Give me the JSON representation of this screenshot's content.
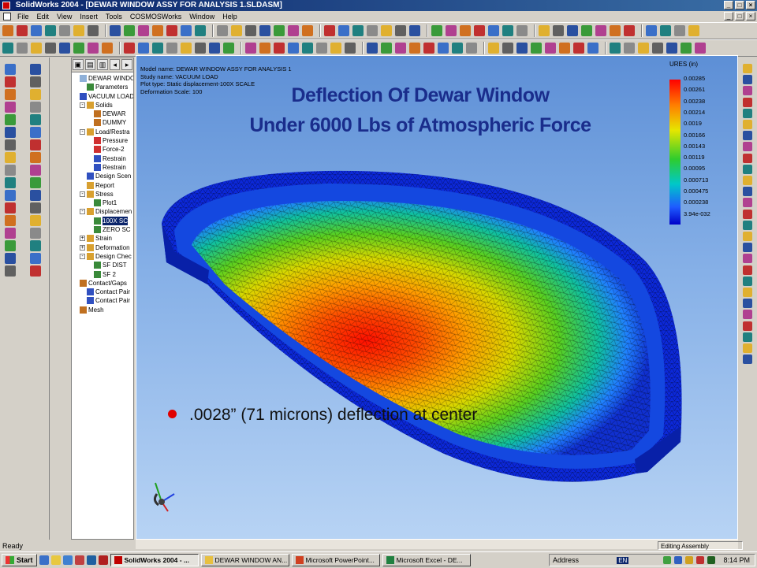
{
  "window": {
    "title": "SolidWorks 2004 - [DEWAR WINDOW ASSY FOR ANALYSIS 1.SLDASM]"
  },
  "menubar": [
    "File",
    "Edit",
    "View",
    "Insert",
    "Tools",
    "COSMOSWorks",
    "Window",
    "Help"
  ],
  "toolbar": {
    "row1_icon_count": 46,
    "row2_icon_count": 47
  },
  "feature_tree": {
    "tabs": [
      "part-icon",
      "properties-icon",
      "config-icon",
      "arrow-left-icon",
      "arrow-right-icon"
    ],
    "items": [
      {
        "label": "DEWAR WINDOW A",
        "indent": 0,
        "exp": "",
        "icon": "#8fb0d8"
      },
      {
        "label": "Parameters",
        "indent": 1,
        "exp": "",
        "icon": "#3a8a3a"
      },
      {
        "label": "VACUUM LOAD",
        "indent": 0,
        "exp": "",
        "icon": "#3050c0"
      },
      {
        "label": "Solids",
        "indent": 1,
        "exp": "-",
        "icon": "#d8a030"
      },
      {
        "label": "DEWAR",
        "indent": 2,
        "exp": "",
        "icon": "#c07020"
      },
      {
        "label": "DUMMY",
        "indent": 2,
        "exp": "",
        "icon": "#c07020"
      },
      {
        "label": "Load/Restra",
        "indent": 1,
        "exp": "-",
        "icon": "#d8a030"
      },
      {
        "label": "Pressure",
        "indent": 2,
        "exp": "",
        "icon": "#d03030"
      },
      {
        "label": "Force-2",
        "indent": 2,
        "exp": "",
        "icon": "#d03030"
      },
      {
        "label": "Restrain",
        "indent": 2,
        "exp": "",
        "icon": "#3050c0"
      },
      {
        "label": "Restrain",
        "indent": 2,
        "exp": "",
        "icon": "#3050c0"
      },
      {
        "label": "Design Scen",
        "indent": 1,
        "exp": "",
        "icon": "#3050c0"
      },
      {
        "label": "Report",
        "indent": 1,
        "exp": "",
        "icon": "#d8a030"
      },
      {
        "label": "Stress",
        "indent": 1,
        "exp": "-",
        "icon": "#d8a030"
      },
      {
        "label": "Plot1",
        "indent": 2,
        "exp": "",
        "icon": "#3a8a3a"
      },
      {
        "label": "Displacemen",
        "indent": 1,
        "exp": "-",
        "icon": "#d8a030"
      },
      {
        "label": "100X SC",
        "indent": 2,
        "exp": "",
        "icon": "#3a8a3a",
        "selected": true
      },
      {
        "label": "ZERO SC",
        "indent": 2,
        "exp": "",
        "icon": "#3a8a3a"
      },
      {
        "label": "Strain",
        "indent": 1,
        "exp": "+",
        "icon": "#d8a030"
      },
      {
        "label": "Deformation",
        "indent": 1,
        "exp": "+",
        "icon": "#d8a030"
      },
      {
        "label": "Design Chec",
        "indent": 1,
        "exp": "-",
        "icon": "#d8a030"
      },
      {
        "label": "SF DIST",
        "indent": 2,
        "exp": "",
        "icon": "#3a8a3a"
      },
      {
        "label": "SF 2",
        "indent": 2,
        "exp": "",
        "icon": "#3a8a3a"
      },
      {
        "label": "Contact/Gaps",
        "indent": 0,
        "exp": "",
        "icon": "#c07020"
      },
      {
        "label": "Contact Pair",
        "indent": 1,
        "exp": "",
        "icon": "#3050c0"
      },
      {
        "label": "Contact Pair",
        "indent": 1,
        "exp": "",
        "icon": "#3050c0"
      },
      {
        "label": "Mesh",
        "indent": 0,
        "exp": "",
        "icon": "#c07020"
      }
    ]
  },
  "plot_info": [
    "Model name: DEWAR WINDOW ASSY FOR ANALYSIS 1",
    "Study name: VACUUM LOAD",
    "Plot type: Static displacement-100X SCALE",
    "Deformation Scale: 100"
  ],
  "slide": {
    "title_line1": "Deflection Of Dewar Window",
    "title_line2": "Under 6000 Lbs of Atmospheric Force",
    "bullet": ".0028” (71 microns) deflection at center"
  },
  "legend": {
    "title": "URES (in)",
    "values": [
      "0.00285",
      "0.00261",
      "0.00238",
      "0.00214",
      "0.0019",
      "0.00166",
      "0.00143",
      "0.00119",
      "0.00095",
      "0.000713",
      "0.000475",
      "0.000238",
      "3.94e-032"
    ]
  },
  "status": {
    "left": "Ready",
    "right": "Editing Assembly"
  },
  "taskbar": {
    "start": "Start",
    "buttons": [
      {
        "label": "SolidWorks 2004 - ...",
        "active": true,
        "color": "#c00000"
      },
      {
        "label": "DEWAR WINDOW AN...",
        "active": false,
        "color": "#e8c040"
      },
      {
        "label": "Microsoft PowerPoint...",
        "active": false,
        "color": "#d04020"
      },
      {
        "label": "Microsoft Excel - DE...",
        "active": false,
        "color": "#208040"
      }
    ],
    "address_label": "Address",
    "language": "EN",
    "clock": "8:14 PM"
  },
  "colors": {
    "title_blue": "#1a2d8c",
    "bullet_red": "#e00000",
    "titlebar": "#0a246a",
    "viewport_top": "#5d8fd6",
    "viewport_bottom": "#b7d3f4"
  }
}
